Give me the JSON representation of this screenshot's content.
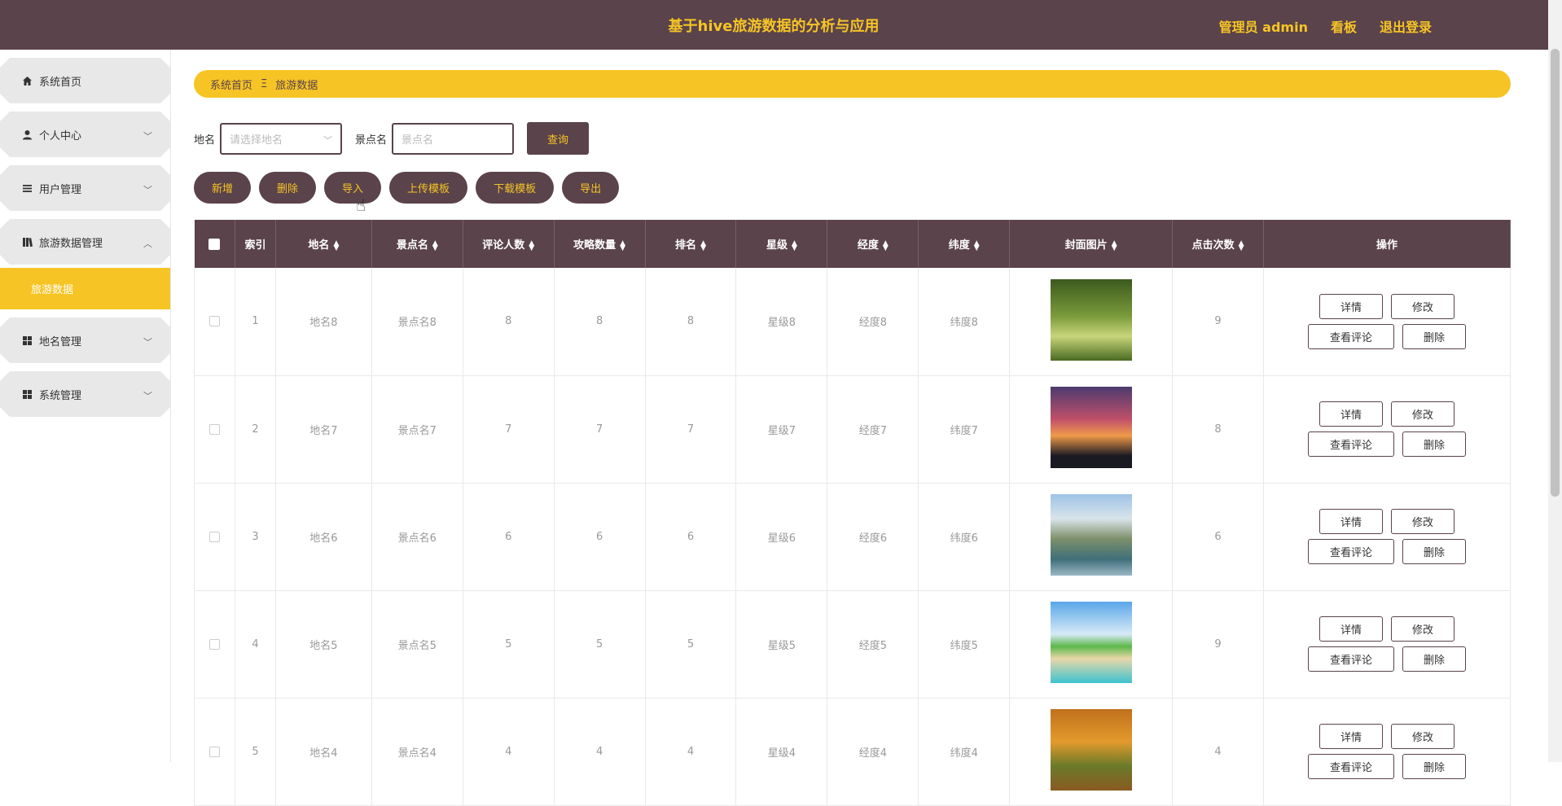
{
  "header": {
    "title": "基于hive旅游数据的分析与应用",
    "admin_label": "管理员 admin",
    "board_label": "看板",
    "logout_label": "退出登录"
  },
  "sidebar": {
    "items": [
      {
        "label": "系统首页",
        "icon": "home-icon"
      },
      {
        "label": "个人中心",
        "icon": "user-icon"
      },
      {
        "label": "用户管理",
        "icon": "list-icon"
      },
      {
        "label": "旅游数据管理",
        "icon": "book-icon"
      },
      {
        "label": "地名管理",
        "icon": "grid-icon"
      },
      {
        "label": "系统管理",
        "icon": "grid-icon"
      }
    ],
    "sub_item": "旅游数据"
  },
  "breadcrumb": {
    "home": "系统首页",
    "separator": "Ξ",
    "current": "旅游数据"
  },
  "search": {
    "place_label": "地名",
    "place_placeholder": "请选择地名",
    "spot_label": "景点名",
    "spot_placeholder": "景点名",
    "query_label": "查询"
  },
  "actions": [
    "新增",
    "删除",
    "导入",
    "上传模板",
    "下载模板",
    "导出"
  ],
  "table": {
    "headers": [
      "索引",
      "地名",
      "景点名",
      "评论人数",
      "攻略数量",
      "排名",
      "星级",
      "经度",
      "纬度",
      "封面图片",
      "点击次数",
      "操作"
    ],
    "rows": [
      {
        "index": "1",
        "place": "地名8",
        "spot": "景点名8",
        "comments": "8",
        "guides": "8",
        "rank": "8",
        "star": "星级8",
        "lng": "经度8",
        "lat": "纬度8",
        "clicks": "9"
      },
      {
        "index": "2",
        "place": "地名7",
        "spot": "景点名7",
        "comments": "7",
        "guides": "7",
        "rank": "7",
        "star": "星级7",
        "lng": "经度7",
        "lat": "纬度7",
        "clicks": "8"
      },
      {
        "index": "3",
        "place": "地名6",
        "spot": "景点名6",
        "comments": "6",
        "guides": "6",
        "rank": "6",
        "star": "星级6",
        "lng": "经度6",
        "lat": "纬度6",
        "clicks": "6"
      },
      {
        "index": "4",
        "place": "地名5",
        "spot": "景点名5",
        "comments": "5",
        "guides": "5",
        "rank": "5",
        "star": "星级5",
        "lng": "经度5",
        "lat": "纬度5",
        "clicks": "9"
      },
      {
        "index": "5",
        "place": "地名4",
        "spot": "景点名4",
        "comments": "4",
        "guides": "4",
        "rank": "4",
        "star": "星级4",
        "lng": "经度4",
        "lat": "纬度4",
        "clicks": "4"
      }
    ],
    "op_labels": {
      "detail": "详情",
      "edit": "修改",
      "comments": "查看评论",
      "delete": "删除"
    }
  },
  "colors": {
    "primary": "#5a434b",
    "accent": "#f6c425"
  }
}
